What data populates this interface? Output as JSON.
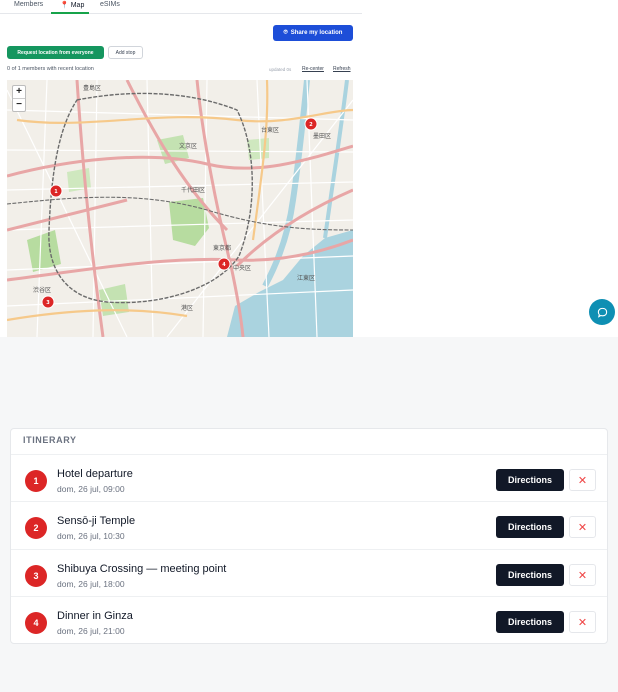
{
  "tabs": [
    {
      "label": "Members"
    },
    {
      "label": "Map"
    },
    {
      "label": "eSIMs"
    }
  ],
  "toolbar": {
    "share_label": "Share my location",
    "request_label": "Request location from everyone",
    "add_stop_label": "Add stop"
  },
  "status": {
    "members_text": "0 of 1 members with recent location",
    "updated_text": "updated 0s",
    "recenter_label": "Re-center",
    "refresh_label": "Refresh"
  },
  "map": {
    "zoom_in": "+",
    "zoom_out": "−",
    "markers": [
      {
        "label": "1"
      },
      {
        "label": "2"
      },
      {
        "label": "3"
      },
      {
        "label": "4"
      }
    ],
    "place_labels": [
      "豊島区",
      "文京区",
      "台東区",
      "墨田区",
      "千代田区",
      "東京都",
      "中央区",
      "渋谷区",
      "港区",
      "江東区"
    ]
  },
  "itinerary": {
    "heading": "ITINERARY",
    "items": [
      {
        "num": "1",
        "title": "Hotel departure",
        "date": "dom, 26 jul, 09:00",
        "directions": "Directions",
        "delete": "✕"
      },
      {
        "num": "2",
        "title": "Sensō-ji Temple",
        "date": "dom, 26 jul, 10:30",
        "directions": "Directions",
        "delete": "✕"
      },
      {
        "num": "3",
        "title": "Shibuya Crossing — meeting point",
        "date": "dom, 26 jul, 18:00",
        "directions": "Directions",
        "delete": "✕"
      },
      {
        "num": "4",
        "title": "Dinner in Ginza",
        "date": "dom, 26 jul, 21:00",
        "directions": "Directions",
        "delete": "✕"
      }
    ]
  },
  "colors": {
    "accent_blue": "#1d4ed8",
    "accent_green": "#15965f",
    "marker_red": "#dc2626",
    "dark_button": "#111827",
    "chat_teal": "#0e8fb3"
  }
}
